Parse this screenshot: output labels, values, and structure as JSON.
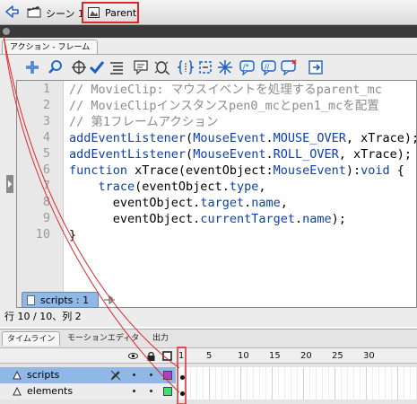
{
  "breadcrumb": {
    "scene_label": "シーン 1",
    "symbol_label": "Parent"
  },
  "actions_panel": {
    "tab_label": "アクション - フレーム",
    "line_numbers": [
      "1",
      "2",
      "3",
      "4",
      "5",
      "6",
      "7",
      "8",
      "9",
      "10"
    ],
    "code_lines": [
      [
        {
          "t": "// MovieClip: マウスイベントを処理するparent_mc",
          "c": "comment"
        }
      ],
      [
        {
          "t": "// MovieClipインスタンスpen0_mcとpen1_mcを配置",
          "c": "comment"
        }
      ],
      [
        {
          "t": "// 第1フレームアクション",
          "c": "comment"
        }
      ],
      [
        {
          "t": "addEventListener",
          "c": "keyword"
        },
        {
          "t": "(",
          "c": "plain"
        },
        {
          "t": "MouseEvent",
          "c": "keyword"
        },
        {
          "t": ".",
          "c": "plain"
        },
        {
          "t": "MOUSE_OVER",
          "c": "keyword"
        },
        {
          "t": ", xTrace);",
          "c": "plain"
        }
      ],
      [
        {
          "t": "addEventListener",
          "c": "keyword"
        },
        {
          "t": "(",
          "c": "plain"
        },
        {
          "t": "MouseEvent",
          "c": "keyword"
        },
        {
          "t": ".",
          "c": "plain"
        },
        {
          "t": "ROLL_OVER",
          "c": "keyword"
        },
        {
          "t": ", xTrace);",
          "c": "plain"
        }
      ],
      [
        {
          "t": "function",
          "c": "keyword"
        },
        {
          "t": " xTrace(eventObject:",
          "c": "plain"
        },
        {
          "t": "MouseEvent",
          "c": "keyword"
        },
        {
          "t": "):",
          "c": "plain"
        },
        {
          "t": "void",
          "c": "keyword"
        },
        {
          "t": " {",
          "c": "plain"
        }
      ],
      [
        {
          "t": "    ",
          "c": "plain"
        },
        {
          "t": "trace",
          "c": "keyword"
        },
        {
          "t": "(eventObject.",
          "c": "plain"
        },
        {
          "t": "type",
          "c": "keyword"
        },
        {
          "t": ",",
          "c": "plain"
        }
      ],
      [
        {
          "t": "      eventObject.",
          "c": "plain"
        },
        {
          "t": "target",
          "c": "keyword"
        },
        {
          "t": ".",
          "c": "plain"
        },
        {
          "t": "name",
          "c": "keyword"
        },
        {
          "t": ",",
          "c": "plain"
        }
      ],
      [
        {
          "t": "      eventObject.",
          "c": "plain"
        },
        {
          "t": "currentTarget",
          "c": "keyword"
        },
        {
          "t": ".",
          "c": "plain"
        },
        {
          "t": "name",
          "c": "keyword"
        },
        {
          "t": ");",
          "c": "plain"
        }
      ],
      [
        {
          "t": "}",
          "c": "plain"
        }
      ]
    ],
    "script_tab_label": "scripts : 1",
    "status_text": "行 10 / 10、列 2"
  },
  "timeline": {
    "tabs": [
      "タイムライン",
      "モーションエディタ",
      "出力"
    ],
    "frame_numbers": [
      "1",
      "5",
      "10",
      "15",
      "20",
      "25",
      "30"
    ],
    "layers": [
      {
        "name": "scripts",
        "selected": true,
        "swatch": "#b23fc8"
      },
      {
        "name": "elements",
        "selected": false,
        "swatch": "#39e36e"
      }
    ]
  },
  "colors": {
    "comment": "#8c8c8c",
    "keyword": "#0b3fb0",
    "plain": "#000000",
    "highlight_border": "#e0262a",
    "selected_layer": "#8fb8e6"
  },
  "icons": {
    "toolbar": [
      "add-action-icon",
      "find-icon",
      "target-path-icon",
      "check-syntax-icon",
      "auto-format-icon",
      "code-hint-icon",
      "debug-options-icon",
      "collapse-between-braces-icon",
      "collapse-selection-icon",
      "expand-all-icon",
      "apply-block-comment-icon",
      "apply-line-comment-icon",
      "remove-comment-icon",
      "show-hide-toolbox-icon",
      "script-assist-icon"
    ]
  }
}
